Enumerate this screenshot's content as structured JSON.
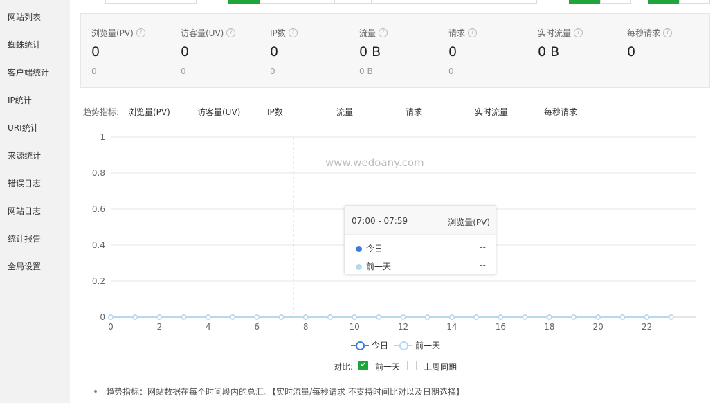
{
  "sidebar": {
    "items": [
      {
        "label": "网站列表"
      },
      {
        "label": "蜘蛛统计"
      },
      {
        "label": "客户端统计"
      },
      {
        "label": "IP统计"
      },
      {
        "label": "URI统计"
      },
      {
        "label": "来源统计"
      },
      {
        "label": "错误日志"
      },
      {
        "label": "网站日志"
      },
      {
        "label": "统计报告"
      },
      {
        "label": "全局设置"
      }
    ]
  },
  "stats": [
    {
      "label": "浏览量(PV)",
      "value": "0",
      "sub": "0"
    },
    {
      "label": "访客量(UV)",
      "value": "0",
      "sub": "0"
    },
    {
      "label": "IP数",
      "value": "0",
      "sub": "0"
    },
    {
      "label": "流量",
      "value": "0 B",
      "sub": "0 B"
    },
    {
      "label": "请求",
      "value": "0",
      "sub": "0"
    },
    {
      "label": "实时流量",
      "value": "0 B",
      "sub": ""
    },
    {
      "label": "每秒请求",
      "value": "0",
      "sub": ""
    }
  ],
  "help_icon_glyph": "?",
  "trend": {
    "label": "趋势指标:",
    "tabs": [
      "浏览量(PV)",
      "访客量(UV)",
      "IP数",
      "流量",
      "请求",
      "实时流量",
      "每秒请求"
    ]
  },
  "watermark": "www.wedoany.com",
  "tooltip": {
    "time": "07:00 - 07:59",
    "metric": "浏览量(PV)",
    "rows": [
      {
        "name": "今日",
        "value": "--",
        "color": "#3b7ddd"
      },
      {
        "name": "前一天",
        "value": "--",
        "color": "#b8d8f0"
      }
    ]
  },
  "chart_data": {
    "type": "line",
    "x": [
      0,
      1,
      2,
      3,
      4,
      5,
      6,
      7,
      8,
      9,
      10,
      11,
      12,
      13,
      14,
      15,
      16,
      17,
      18,
      19,
      20,
      21,
      22,
      23
    ],
    "x_tick_labels": [
      "0",
      "2",
      "4",
      "6",
      "8",
      "10",
      "12",
      "14",
      "16",
      "18",
      "20",
      "22"
    ],
    "y_tick_labels": [
      "0",
      "0.2",
      "0.4",
      "0.6",
      "0.8",
      "1"
    ],
    "ylim": [
      0,
      1
    ],
    "grid": true,
    "series": [
      {
        "name": "今日",
        "values": [
          0,
          0,
          0,
          0,
          0,
          0,
          0,
          0,
          0,
          0,
          0,
          0,
          0,
          0,
          0,
          0,
          0,
          0,
          0,
          0,
          0,
          0,
          0,
          0
        ],
        "color": "#3b7ddd"
      },
      {
        "name": "前一天",
        "values": [
          0,
          0,
          0,
          0,
          0,
          0,
          0,
          0,
          0,
          0,
          0,
          0,
          0,
          0,
          0,
          0,
          0,
          0,
          0,
          0,
          0,
          0,
          0,
          0
        ],
        "color": "#b8d8f0"
      }
    ],
    "legend": "bottom-center",
    "hover_x": 7.5
  },
  "compare": {
    "label": "对比:",
    "check_glyph": "✔",
    "options": [
      {
        "label": "前一天",
        "checked": true
      },
      {
        "label": "上周同期",
        "checked": false
      }
    ]
  },
  "note": "趋势指标：网站数据在每个时间段内的总汇。【实时流量/每秒请求 不支持时间比对以及日期选择】",
  "colors": {
    "accent": "#20a53a",
    "today": "#3b7ddd",
    "previous": "#b8d8f0"
  }
}
